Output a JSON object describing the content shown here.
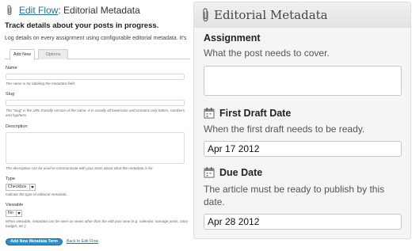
{
  "left": {
    "breadcrumb": {
      "link": "Edit Flow",
      "separator": ":",
      "page": "Editorial Metadata"
    },
    "subheading": "Track details about your posts in progress.",
    "description": "Log details on every assignment using configurable editorial metadata. It's",
    "tabs": [
      {
        "label": "Add New"
      },
      {
        "label": "Options"
      }
    ],
    "fields": {
      "name_label": "Name",
      "name_hint": "The name is for labeling the metadata field.",
      "slug_label": "Slug",
      "slug_hint": "The \"slug\" is the URL-friendly version of the name. It is usually all lowercase and contains only letters, numbers, and hyphens.",
      "description_label": "Description",
      "description_hint": "The description can be used to communicate with your team about what the metadata is for.",
      "type_label": "Type",
      "type_value": "Checkbox",
      "type_hint": "Indicate the type of editorial metadata.",
      "viewable_label": "Viewable",
      "viewable_value": "No",
      "viewable_hint": "When viewable, metadata can be seen on views other than the edit post view (e.g. calendar, manage posts, story budget, etc.)"
    },
    "add_button": "Add New Metadata Term",
    "back_link": "Back to Edit Flow"
  },
  "right": {
    "title": "Editorial Metadata",
    "assignment": {
      "label": "Assignment",
      "description": "What the post needs to cover."
    },
    "first_draft": {
      "label": "First Draft Date",
      "description": "When the first draft needs to be ready.",
      "value": "Apr 17 2012"
    },
    "due_date": {
      "label": "Due Date",
      "description": "The article must be ready to publish by this date.",
      "value": "Apr 28 2012"
    }
  },
  "colors": {
    "link": "#21759b",
    "button": "#2a8fc7",
    "panel_bg": "#f5f5f5"
  },
  "icons": {
    "header": "paperclip-icon",
    "date": "calendar-icon",
    "select": "chevron-down-icon"
  }
}
